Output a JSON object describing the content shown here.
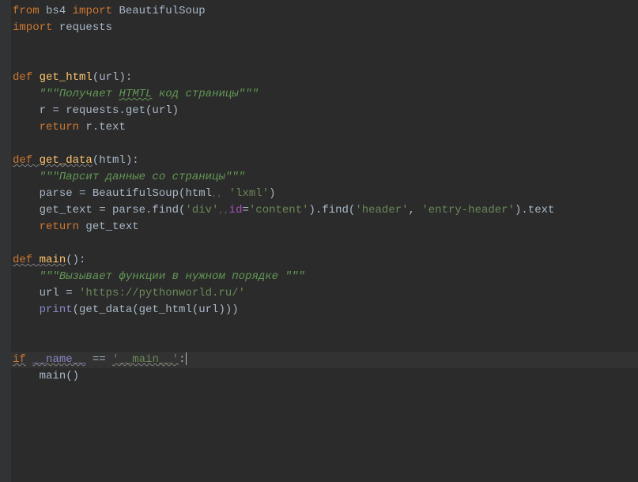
{
  "lines": {
    "l1_from": "from",
    "l1_bs4": "bs4",
    "l1_import": "import",
    "l1_BeautifulSoup": "BeautifulSoup",
    "l2_import": "import",
    "l2_requests": "requests",
    "l5_def": "def",
    "l5_fn": "get_html",
    "l5_params": "(url):",
    "l6_doc": "\"\"\"Получает ",
    "l6_htmtl": "HTMTL",
    "l6_doc2": " код страницы\"\"\"",
    "l7_assign": "r = requests.get(url)",
    "l8_return": "return",
    "l8_expr": " r.text",
    "l10_def": "def ",
    "l10_fn": "get_data",
    "l10_params": "(html):",
    "l11_doc": "\"\"\"Парсит данные со страницы\"\"\"",
    "l12_parse": "parse = BeautifulSoup(html",
    "l12_hint": ",,",
    "l12_lxml": "'lxml'",
    "l12_close": ")",
    "l13a": "get_text = parse.find(",
    "l13_div": "'div'",
    "l13_hint": ",,",
    "l13_id": "id",
    "l13_eq": "=",
    "l13_content": "'content'",
    "l13b": ").find(",
    "l13_header": "'header'",
    "l13_comma": ", ",
    "l13_entry": "'entry-header'",
    "l13c": ").text",
    "l14_return": "return",
    "l14_expr": " get_text",
    "l16_def": "def ",
    "l16_fn": "main",
    "l16_params": "():",
    "l17_doc": "\"\"\"Вызывает функции в нужном порядке \"\"\"",
    "l18_url": "url = ",
    "l18_str": "'https://pythonworld.ru/'",
    "l19_print": "print",
    "l19_args": "(get_data(get_html(url)))",
    "l22_if": "if",
    "l22_name": "__name__",
    "l22_eq": " == ",
    "l22_main": "'__main__'",
    "l22_colon": ":",
    "l23_main": "main()"
  }
}
